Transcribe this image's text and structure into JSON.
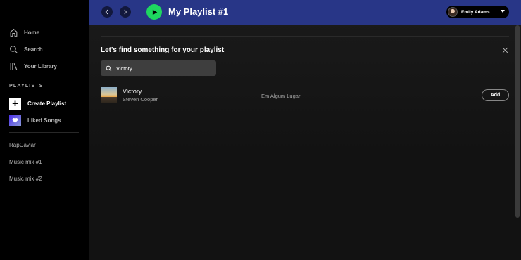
{
  "sidebar": {
    "nav": [
      {
        "label": "Home",
        "icon": "home-icon"
      },
      {
        "label": "Search",
        "icon": "search-icon"
      },
      {
        "label": "Your Library",
        "icon": "library-icon"
      }
    ],
    "playlists_title": "PLAYLISTS",
    "create_playlist": "Create Playlist",
    "liked_songs": "Liked Songs",
    "playlists": [
      "RapCaviar",
      "Music mix #1",
      "Music mix #2"
    ]
  },
  "header": {
    "playlist_title": "My Playlist #1",
    "user_name": "Emily Adams",
    "bar_color": "#283687",
    "accent": "#1ed760"
  },
  "finder": {
    "heading": "Let's find something for your playlist",
    "search_value": "Victory",
    "results": [
      {
        "title": "Victory",
        "artist": "Steven Cooper",
        "album": "Em Algum Lugar",
        "action": "Add"
      }
    ]
  }
}
